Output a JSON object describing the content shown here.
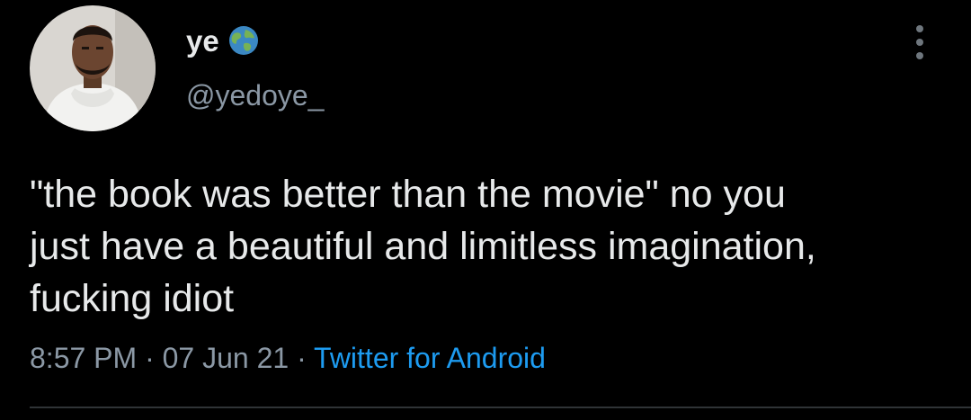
{
  "user": {
    "display_name": "ye",
    "badge_icon": "globe-earth-icon",
    "handle": "@yedoye_",
    "avatar_icon": "profile-photo"
  },
  "tweet": {
    "text": "\"the book was better than the movie\" no you\njust have a beautiful and limitless imagination,\nfucking idiot",
    "time": "8:57 PM",
    "separator": "·",
    "date": "07 Jun 21",
    "source": "Twitter for Android"
  },
  "menu": {
    "icon": "more-vertical-icon"
  },
  "colors": {
    "background": "#000000",
    "primary_text": "#e7e9ea",
    "secondary_text": "#8b98a5",
    "link": "#1d9bf0",
    "divider": "#2f3336"
  }
}
